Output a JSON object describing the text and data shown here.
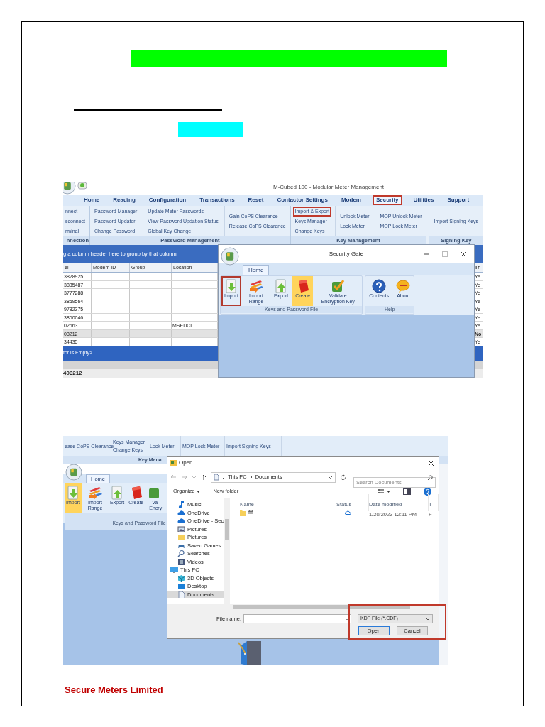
{
  "dash_mark": "–",
  "screenshot_1": {
    "app_title": "M-Cubed 100 - Modular Meter Management",
    "menu_tabs": [
      {
        "label": "Home",
        "selected": false
      },
      {
        "label": "Reading",
        "selected": false
      },
      {
        "label": "Configuration",
        "selected": false
      },
      {
        "label": "Transactions",
        "selected": false
      },
      {
        "label": "Reset",
        "selected": false
      },
      {
        "label": "Contactor Settings",
        "selected": false
      },
      {
        "label": "Modem",
        "selected": false
      },
      {
        "label": "Security",
        "selected": true
      },
      {
        "label": "Utilities",
        "selected": false
      },
      {
        "label": "Support",
        "selected": false
      }
    ],
    "ribbon_groups": [
      {
        "label": "nnection",
        "columns": [
          [
            {
              "label": "nnect",
              "highlighted": false
            },
            {
              "label": "sconnect",
              "highlighted": false
            },
            {
              "label": "rminal",
              "highlighted": false
            }
          ]
        ]
      },
      {
        "label": "Password Management",
        "columns": [
          [
            {
              "label": "Password Manager",
              "highlighted": false
            },
            {
              "label": "Password Updator",
              "highlighted": false
            },
            {
              "label": "Change Password",
              "highlighted": false
            }
          ],
          [
            {
              "label": "Update Meter Passwords",
              "highlighted": false
            },
            {
              "label": "View Password Updation Status",
              "highlighted": false
            },
            {
              "label": "Global Key Change",
              "highlighted": false
            }
          ],
          [
            {
              "label": "Gain CoPS Clearance",
              "highlighted": false
            },
            {
              "label": "Release CoPS Clearance",
              "highlighted": false
            }
          ]
        ]
      },
      {
        "label": "Key Management",
        "columns": [
          [
            {
              "label": "Import & Export",
              "highlighted": true
            },
            {
              "label": "Keys Manager",
              "highlighted": false
            },
            {
              "label": "Change Keys",
              "highlighted": false
            }
          ],
          [
            {
              "label": "Unlock Meter",
              "highlighted": false
            },
            {
              "label": "Lock Meter",
              "highlighted": false
            }
          ],
          [
            {
              "label": "MOP Unlock Meter",
              "highlighted": false
            },
            {
              "label": "MOP Lock Meter",
              "highlighted": false
            }
          ]
        ]
      },
      {
        "label": "Signing Key",
        "columns": [
          [
            {
              "label": "Import Signing Keys",
              "highlighted": false
            }
          ]
        ]
      }
    ],
    "group_by_hint": "g a column header here to group by that column",
    "grid": {
      "columns": [
        "el",
        "Modem ID",
        "Group",
        "Location"
      ],
      "column_5": "Tr",
      "rows": [
        {
          "serial": "3828925",
          "column_5": "Ye",
          "selected": false
        },
        {
          "serial": "3885487",
          "column_5": "Ye",
          "selected": false
        },
        {
          "serial": "3777288",
          "column_5": "Ye",
          "selected": false
        },
        {
          "serial": "3859564",
          "column_5": "Ye",
          "selected": false
        },
        {
          "serial": "9782375",
          "column_5": "Ye",
          "selected": false
        },
        {
          "serial": "3860046",
          "column_5": "Ye",
          "selected": false
        },
        {
          "serial": "02663",
          "location": "MSEDCL",
          "column_5": "Ye",
          "selected": false
        },
        {
          "serial": "03212",
          "column_5": "No",
          "selected": true
        },
        {
          "serial": "34435",
          "column_5": "Ye",
          "selected": false
        }
      ]
    },
    "filter_bar": "tor is Empty>",
    "status_value": "403212",
    "dialog": {
      "title": "Security Gate",
      "tab": "Home",
      "groups": [
        {
          "label": "Keys and Password File",
          "buttons": [
            {
              "label": "Import",
              "kind": "import",
              "highlighted": true,
              "active": false
            },
            {
              "label": "Import Range",
              "kind": "import_range",
              "highlighted": false,
              "active": false
            },
            {
              "label": "Export",
              "kind": "export",
              "highlighted": false,
              "active": false
            },
            {
              "label": "Create",
              "kind": "create",
              "highlighted": false,
              "active": true
            },
            {
              "label": "Validate Encryption Key",
              "kind": "validate",
              "highlighted": false,
              "active": false
            }
          ]
        },
        {
          "label": "Help",
          "buttons": [
            {
              "label": "Contents",
              "kind": "contents",
              "highlighted": false,
              "active": false
            },
            {
              "label": "About",
              "kind": "about",
              "highlighted": false,
              "active": false
            }
          ]
        }
      ]
    }
  },
  "screenshot_2": {
    "ribbon_columns": [
      [
        "ease CoPS Clearance"
      ],
      [
        "Keys Manager",
        "Change Keys"
      ],
      [
        "Lock Meter"
      ],
      [
        "MOP Lock Meter"
      ],
      [
        "Import Signing Keys"
      ]
    ],
    "ribbon_group_label": "Key Mana",
    "security_gate": {
      "tab": "Home",
      "group_label": "Keys and Password File",
      "buttons": [
        {
          "label": "Import",
          "kind": "import",
          "active": true
        },
        {
          "label": "Import Range",
          "kind": "import_range",
          "active": false
        },
        {
          "label": "Export",
          "kind": "export",
          "active": false
        },
        {
          "label": "Create",
          "kind": "create",
          "active": false
        },
        {
          "label": "Va Encry",
          "kind": "validate_cut",
          "active": false
        }
      ]
    },
    "open_dialog": {
      "title": "Open",
      "path": [
        "This PC",
        "Documents"
      ],
      "search_placeholder": "Search Documents",
      "toolbar": {
        "organize": "Organize",
        "new_folder": "New folder"
      },
      "nav": [
        {
          "label": "Music",
          "kind": "music",
          "selected": false
        },
        {
          "label": "OneDrive",
          "kind": "cloud",
          "selected": false
        },
        {
          "label": "OneDrive - Sec",
          "kind": "cloud",
          "selected": false
        },
        {
          "label": "Pictures",
          "kind": "pictures",
          "selected": false
        },
        {
          "label": "Pictures",
          "kind": "folder",
          "selected": false
        },
        {
          "label": "Saved Games",
          "kind": "games",
          "selected": false
        },
        {
          "label": "Searches",
          "kind": "search",
          "selected": false
        },
        {
          "label": "Videos",
          "kind": "videos",
          "selected": false
        },
        {
          "label": "This PC",
          "kind": "pc",
          "selected": false,
          "children": [
            {
              "label": "3D Objects",
              "kind": "cube",
              "selected": false
            },
            {
              "label": "Desktop",
              "kind": "desktop",
              "selected": false
            },
            {
              "label": "Documents",
              "kind": "document",
              "selected": true
            }
          ]
        }
      ],
      "columns": [
        "Name",
        "Status",
        "Date modified",
        "T"
      ],
      "files": [
        {
          "name": "fff",
          "date": "1/20/2023 12:11 PM",
          "column_4": "F"
        }
      ],
      "file_name_label": "File name:",
      "file_type": "KDF File (*.CDF)",
      "buttons": [
        "Open",
        "Cancel"
      ]
    }
  },
  "footer": "Secure Meters Limited"
}
